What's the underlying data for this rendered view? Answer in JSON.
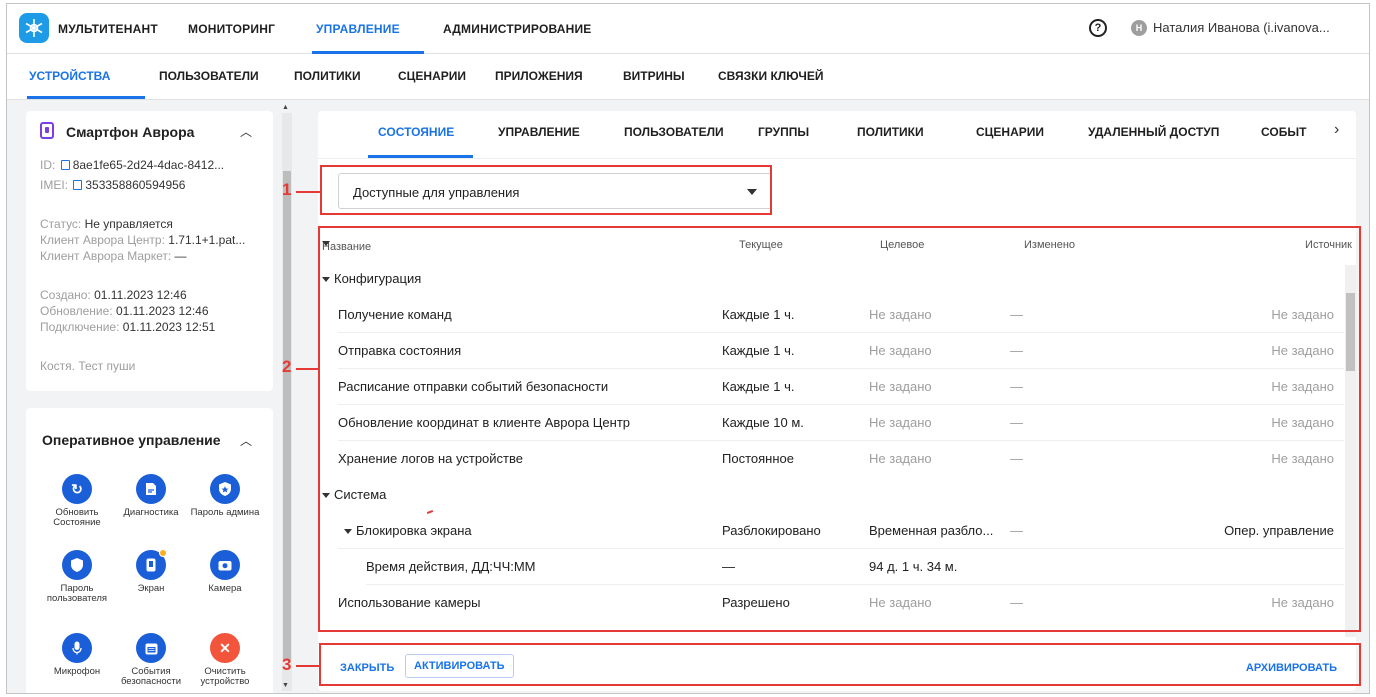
{
  "topnav": {
    "items": [
      "МУЛЬТИТЕНАНТ",
      "МОНИТОРИНГ",
      "УПРАВЛЕНИЕ",
      "АДМИНИСТРИРОВАНИЕ"
    ],
    "user_initial": "Н",
    "user": "Наталия Иванова (i.ivanova..."
  },
  "subnav": {
    "items": [
      "УСТРОЙСТВА",
      "ПОЛЬЗОВАТЕЛИ",
      "ПОЛИТИКИ",
      "СЦЕНАРИИ",
      "ПРИЛОЖЕНИЯ",
      "ВИТРИНЫ",
      "СВЯЗКИ КЛЮЧЕЙ"
    ]
  },
  "device": {
    "title": "Смартфон Аврора",
    "id_label": "ID:",
    "id_value": "8ae1fe65-2d24-4dac-8412...",
    "imei_label": "IMEI:",
    "imei_value": "353358860594956",
    "status_label": "Статус:",
    "status_value": "Не управляется",
    "client_center_label": "Клиент Аврора Центр:",
    "client_center_value": "1.71.1+1.pat...",
    "client_market_label": "Клиент Аврора Маркет:",
    "client_market_value": "—",
    "created_label": "Создано:",
    "created_value": "01.11.2023 12:46",
    "updated_label": "Обновление:",
    "updated_value": "01.11.2023 12:46",
    "connected_label": "Подключение:",
    "connected_value": "01.11.2023 12:51",
    "note": "Костя. Тест пуши"
  },
  "quick": {
    "title": "Оперативное управление",
    "buttons": [
      {
        "label": "Обновить Состояние",
        "icon": "refresh-icon"
      },
      {
        "label": "Диагностика",
        "icon": "document-icon"
      },
      {
        "label": "Пароль админа",
        "icon": "shield-star-icon"
      },
      {
        "label": "Пароль пользователя",
        "icon": "shield-icon"
      },
      {
        "label": "Экран",
        "icon": "screen-icon"
      },
      {
        "label": "Камера",
        "icon": "camera-icon"
      },
      {
        "label": "Микрофон",
        "icon": "microphone-icon"
      },
      {
        "label": "События безопасности",
        "icon": "calendar-icon"
      },
      {
        "label": "Очистить устройство",
        "icon": "close-icon"
      }
    ]
  },
  "tabs": [
    "СОСТОЯНИЕ",
    "УПРАВЛЕНИЕ",
    "ПОЛЬЗОВАТЕЛИ",
    "ГРУППЫ",
    "ПОЛИТИКИ",
    "СЦЕНАРИИ",
    "УДАЛЕННЫЙ ДОСТУП",
    "СОБЫТ"
  ],
  "filter": {
    "value": "Доступные для управления"
  },
  "table": {
    "headers": {
      "name": "Название",
      "current": "Текущее",
      "target": "Целевое",
      "changed": "Изменено",
      "source": "Источник"
    },
    "rows": [
      {
        "type": "group",
        "name": "Конфигурация"
      },
      {
        "type": "item",
        "name": "Получение команд",
        "current": "Каждые 1 ч.",
        "target": "Не задано",
        "changed": "—",
        "source": "Не задано"
      },
      {
        "type": "item",
        "name": "Отправка состояния",
        "current": "Каждые 1 ч.",
        "target": "Не задано",
        "changed": "—",
        "source": "Не задано"
      },
      {
        "type": "item",
        "name": "Расписание отправки событий безопасности",
        "current": "Каждые 1 ч.",
        "target": "Не задано",
        "changed": "—",
        "source": "Не задано"
      },
      {
        "type": "item",
        "name": "Обновление координат в клиенте Аврора Центр",
        "current": "Каждые 10 м.",
        "target": "Не задано",
        "changed": "—",
        "source": "Не задано"
      },
      {
        "type": "item",
        "name": "Хранение логов на устройстве",
        "current": "Постоянное",
        "target": "Не задано",
        "changed": "—",
        "source": "Не задано"
      },
      {
        "type": "group",
        "name": "Система"
      },
      {
        "type": "subgroup",
        "name": "Блокировка экрана",
        "current": "Разблокировано",
        "target": "Временная разбло...",
        "changed": "—",
        "source": "Опер. управление"
      },
      {
        "type": "child",
        "name": "Время действия, ДД:ЧЧ:ММ",
        "current": "—",
        "target": "94 д. 1 ч. 34 м.",
        "changed": "",
        "source": ""
      },
      {
        "type": "item",
        "name": "Использование камеры",
        "current": "Разрешено",
        "target": "Не задано",
        "changed": "—",
        "source": "Не задано"
      }
    ]
  },
  "footer": {
    "close": "ЗАКРЫТЬ",
    "activate": "АКТИВИРОВАТЬ",
    "archive": "АРХИВИРОВАТЬ"
  },
  "annotations": [
    "1",
    "2",
    "3"
  ],
  "colors": {
    "accent": "#1a73e8",
    "annotation": "#e53935",
    "danger": "#f2553b"
  }
}
